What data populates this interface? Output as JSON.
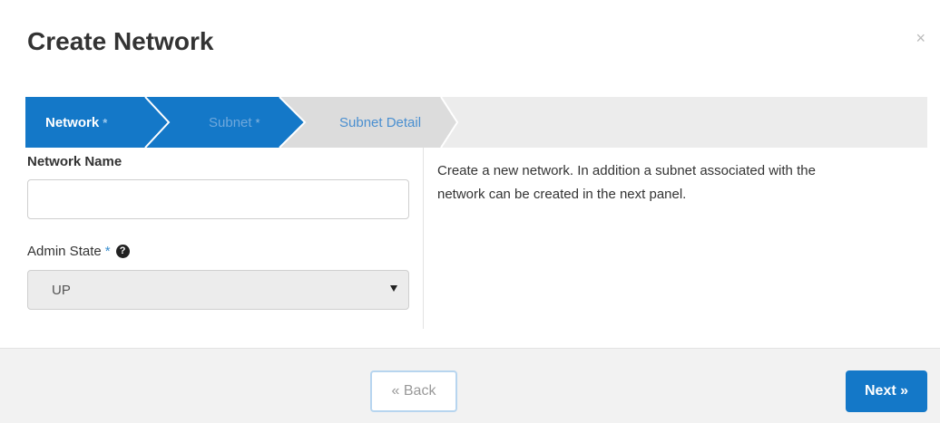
{
  "dialog": {
    "title": "Create Network",
    "close_glyph": "×"
  },
  "wizard": {
    "steps": [
      {
        "label": "Network",
        "required_mark": "*",
        "state": "active"
      },
      {
        "label": "Subnet",
        "required_mark": "*",
        "state": "active"
      },
      {
        "label": "Subnet Detail",
        "required_mark": "",
        "state": "next"
      }
    ]
  },
  "form": {
    "network_name": {
      "label": "Network Name",
      "value": "",
      "placeholder": ""
    },
    "admin_state": {
      "label": "Admin State",
      "required_mark": "*",
      "help_icon": "question-circle-icon",
      "selected": "UP"
    }
  },
  "help": {
    "text": "Create a new network. In addition a subnet associated with the network can be created in the next panel."
  },
  "footer": {
    "back_label": "« Back",
    "next_label": "Next »"
  },
  "colors": {
    "primary": "#1478c8",
    "wizard_inactive": "#dcdcdc",
    "footer_bg": "#f2f2f2"
  }
}
